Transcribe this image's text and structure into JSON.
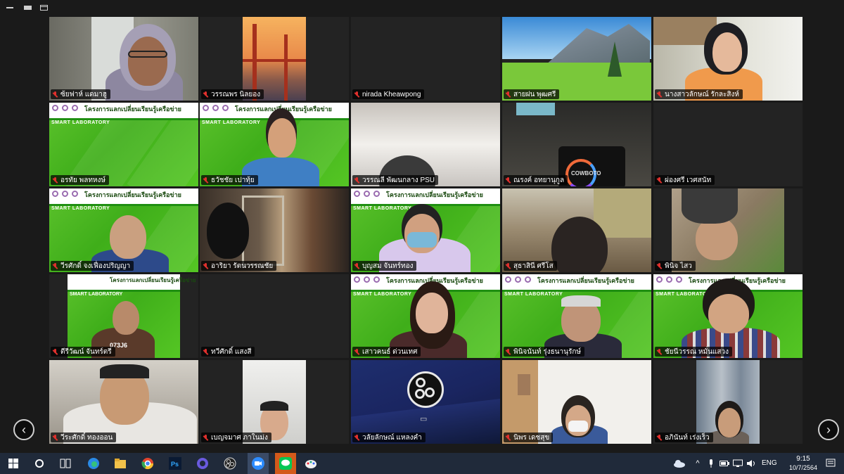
{
  "tiles": [
    {
      "name": "ซ้ยฟาห์ แดมาฮู"
    },
    {
      "name": "วรรณพร นิลยอง"
    },
    {
      "name": "nirada Kheawpong"
    },
    {
      "name": "สายฝน พุฒศรี"
    },
    {
      "name": "นางสาวลักษณ์ รักละสิงห์"
    },
    {
      "name": "อรทัย พลทหงษ์"
    },
    {
      "name": "ธวัชชัย เปาทุ้ย"
    },
    {
      "name": "วรรณลี พัฒนกลาง PSU"
    },
    {
      "name": "ณรงค์ อทยานุกูล"
    },
    {
      "name": "ผ่องศรี เวศสนัท"
    },
    {
      "name": "วีรศักดิ์ จงเฟื่องปริญญา"
    },
    {
      "name": "อาริยา รัตนวรรณชัย"
    },
    {
      "name": "บุญสม จันทร์ทอง"
    },
    {
      "name": "สุธาสินี ศรีโส"
    },
    {
      "name": "พินิจ ไสว"
    },
    {
      "name": "ตีรีวัฒน์ จันทร์ตรี"
    },
    {
      "name": "ทวีศักดิ์ แสงสี"
    },
    {
      "name": "เสาวคนธ์ ด่วนเทศ"
    },
    {
      "name": "พินิจนันท์ รุ่งธนานุรักษ์"
    },
    {
      "name": "ชัยนีวรรณ หมั่นแสวง"
    },
    {
      "name": "วีระศักดิ์ ทองออน"
    },
    {
      "name": "เบญจมาศ ภาในม่ง"
    },
    {
      "name": "วลัยลักษณ์ แหลงคำ"
    },
    {
      "name": "นิพร เดชสุข"
    },
    {
      "name": "อภินันท์ เร่งเร็ว"
    }
  ],
  "banner_text": "โครงการแลกเปลี่ยนเรียนรู้เครือข่าย",
  "smart_lab_text": "SMART LABORATORY",
  "camera_text": "COWBOTO",
  "tshirt_text": "073J6",
  "clock": {
    "time": "9:15",
    "date": "10/7/2564"
  },
  "language": "ENG",
  "colors": {
    "muted_mic": "#e0302d",
    "taskbar": "#202a3a",
    "tile_bg": "#232323"
  }
}
